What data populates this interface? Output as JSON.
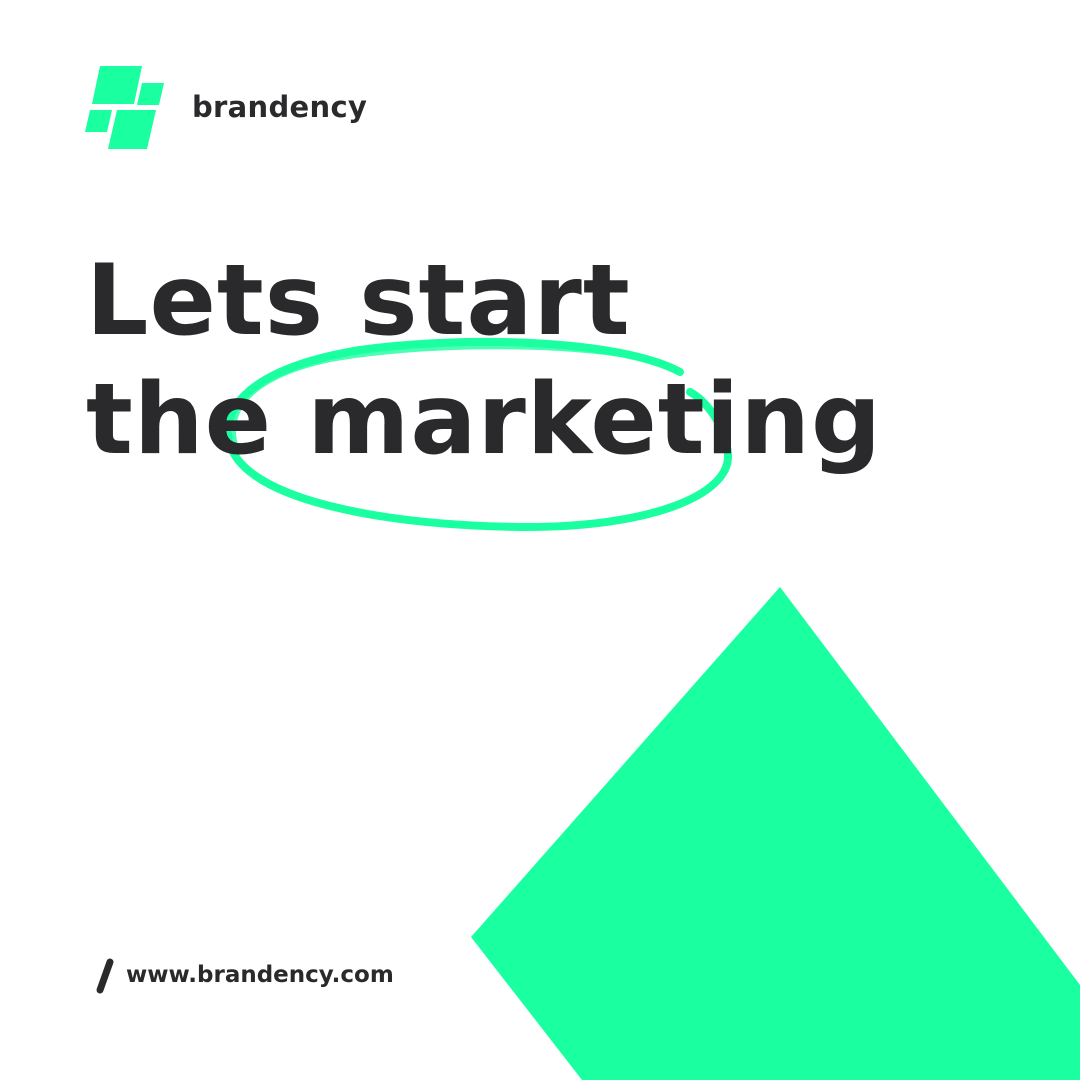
{
  "brand": {
    "name": "brandency",
    "logo_icon": "stacked-parallelogram-logo"
  },
  "headline": {
    "line1": "Lets start",
    "line2": "the marketing",
    "highlighted_word": "marketing"
  },
  "footer": {
    "url": "www.brandency.com",
    "icon": "slash-icon"
  },
  "colors": {
    "accent": "#1affa0",
    "text": "#2a2a2c",
    "background": "#ffffff"
  }
}
